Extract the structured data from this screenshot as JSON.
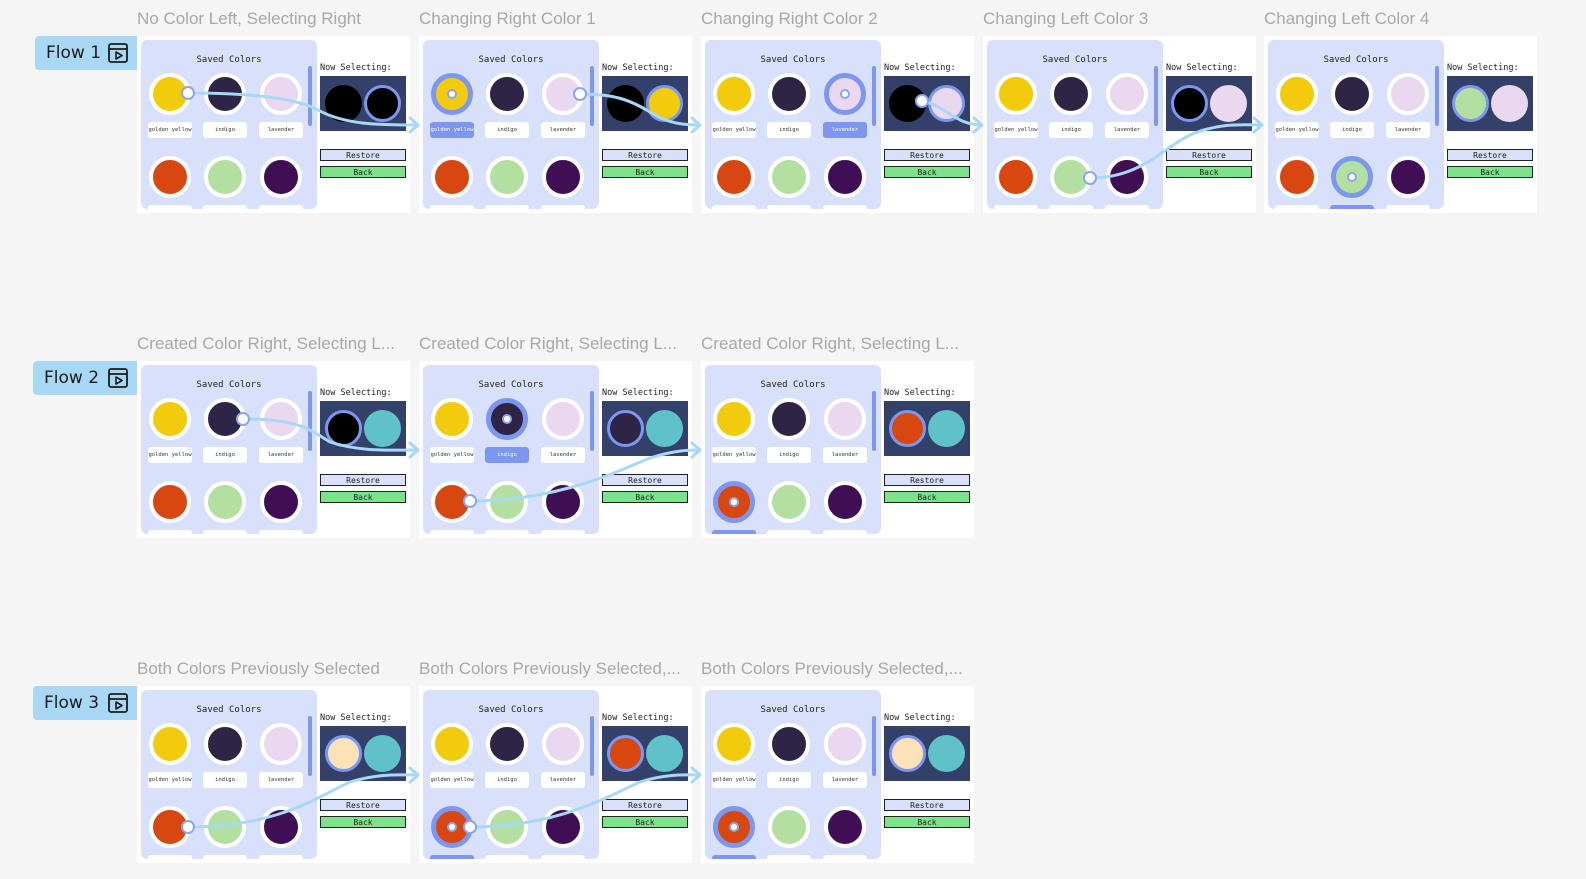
{
  "colors": {
    "golden_yellow": "#f2cc0c",
    "indigo": "#2e2546",
    "lavender": "#ead7f0",
    "vermilion": "#d8470f",
    "sage": "#b3e0a0",
    "plum": "#3f0e55",
    "black": "#000000",
    "peach": "#fde2b8",
    "teal": "#5fc2c8",
    "swatch_bg": "#33406a",
    "panel_bg": "#d8e0fb",
    "accent": "#7d97f0",
    "back_green": "#7de38a",
    "connector": "#a8d8f5"
  },
  "ui": {
    "panel_title": "Saved Colors",
    "now_selecting": "Now Selecting:",
    "restore_label": "Restore",
    "back_label": "Back",
    "color_names": [
      "golden yellow",
      "indigo",
      "lavender"
    ]
  },
  "icons": {
    "flow": "play-window-icon"
  },
  "flows": [
    {
      "label": "Flow 1",
      "frames": [
        {
          "title": "No Color Left, Selecting Right",
          "left": "black",
          "right": "black",
          "selected_side": "right",
          "highlight": null
        },
        {
          "title": "Changing Right Color 1",
          "left": "black",
          "right": "golden_yellow",
          "selected_side": "right",
          "highlight": 0
        },
        {
          "title": "Changing Right Color 2",
          "left": "black",
          "right": "lavender",
          "selected_side": "right",
          "highlight": 2
        },
        {
          "title": "Changing Left Color 3",
          "left": "black",
          "right": "lavender",
          "selected_side": "left",
          "highlight": null
        },
        {
          "title": "Changing Left Color 4",
          "left": "sage",
          "right": "lavender",
          "selected_side": "left",
          "highlight": 4
        }
      ]
    },
    {
      "label": "Flow 2",
      "frames": [
        {
          "title": "Created Color Right, Selecting L...",
          "left": "black",
          "right": "teal",
          "selected_side": "left",
          "highlight": null
        },
        {
          "title": "Created Color Right, Selecting L...",
          "left": "indigo",
          "right": "teal",
          "selected_side": "left",
          "highlight": 1
        },
        {
          "title": "Created Color Right, Selecting L...",
          "left": "vermilion",
          "right": "teal",
          "selected_side": "left",
          "highlight": 3
        }
      ]
    },
    {
      "label": "Flow 3",
      "frames": [
        {
          "title": "Both Colors Previously Selected",
          "left": "peach",
          "right": "teal",
          "selected_side": "left",
          "highlight": null
        },
        {
          "title": "Both Colors Previously Selected,...",
          "left": "vermilion",
          "right": "teal",
          "selected_side": "left",
          "highlight": 3
        },
        {
          "title": "Both Colors Previously Selected,...",
          "left": "peach",
          "right": "teal",
          "selected_side": "left",
          "highlight": 3
        }
      ]
    }
  ]
}
